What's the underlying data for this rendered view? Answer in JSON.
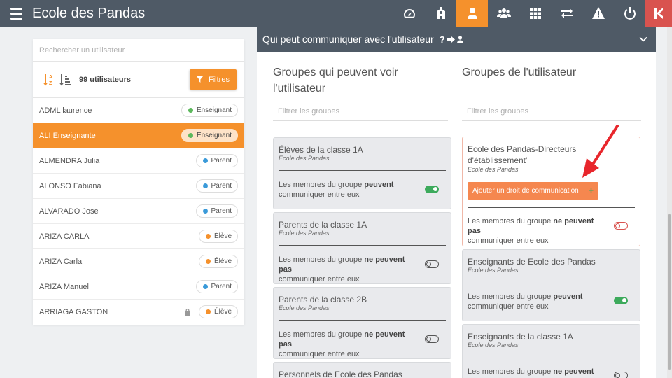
{
  "app": {
    "title": "Ecole des Pandas"
  },
  "user_list": {
    "search_placeholder": "Rechercher un utilisateur",
    "count": "99 utilisateurs",
    "filter_label": "Filtres",
    "users": [
      {
        "name": "ADML laurence",
        "role": "Enseignant",
        "role_color": "#5cb85c"
      },
      {
        "name": "ALI Enseignante",
        "role": "Enseignant",
        "role_color": "#5cb85c"
      },
      {
        "name": "ALMENDRA Julia",
        "role": "Parent",
        "role_color": "#3a9ad9"
      },
      {
        "name": "ALONSO Fabiana",
        "role": "Parent",
        "role_color": "#3a9ad9"
      },
      {
        "name": "ALVARADO Jose",
        "role": "Parent",
        "role_color": "#3a9ad9"
      },
      {
        "name": "ARIZA CARLA",
        "role": "Élève",
        "role_color": "#f5912c"
      },
      {
        "name": "ARIZA Carla",
        "role": "Élève",
        "role_color": "#f5912c"
      },
      {
        "name": "ARIZA Manuel",
        "role": "Parent",
        "role_color": "#3a9ad9"
      },
      {
        "name": "ARRIAGA GASTON",
        "role": "Élève",
        "role_color": "#f5912c"
      }
    ]
  },
  "panel": {
    "header_title": "Qui peut communiquer avec l'utilisateur",
    "header_mark": "?",
    "left_title": "Groupes qui peuvent voir l'utilisateur",
    "right_title": "Groupes de l'utilisateur",
    "filter_placeholder": "Filtrer les groupes",
    "add_button_label": "Ajouter un droit de communication",
    "add_button_plus": "+",
    "left_groups": [
      {
        "title": "Élèves de la classe 1A",
        "school": "Ecole des Pandas",
        "desc_pre": "Les membres du groupe ",
        "desc_bold": "peuvent",
        "desc_post": "communiquer entre eux"
      },
      {
        "title": "Parents de la classe 1A",
        "school": "Ecole des Pandas",
        "desc_pre": "Les membres du groupe ",
        "desc_bold": "ne peuvent pas",
        "desc_post": "communiquer entre eux"
      },
      {
        "title": "Parents de la classe 2B",
        "school": "Ecole des Pandas",
        "desc_pre": "Les membres du groupe ",
        "desc_bold": "ne peuvent pas",
        "desc_post": "communiquer entre eux"
      },
      {
        "title": "Personnels de Ecole des Pandas"
      }
    ],
    "right_groups": [
      {
        "title": "Ecole des Pandas-Directeurs d'établissement'",
        "school": "Ecole des Pandas",
        "desc_pre": "Les membres du groupe ",
        "desc_bold": "ne peuvent pas",
        "desc_post": "communiquer entre eux"
      },
      {
        "title": "Enseignants de Ecole des Pandas",
        "school": "Ecole des Pandas",
        "desc_pre": "Les membres du groupe ",
        "desc_bold": "peuvent",
        "desc_post": "communiquer entre eux"
      },
      {
        "title": "Enseignants de la classe 1A",
        "school": "Ecole des Pandas",
        "desc_pre": "Les membres du groupe ",
        "desc_bold": "ne peuvent pas"
      }
    ]
  },
  "colors": {
    "accent": "#f5912c",
    "topbar": "#4f5a66",
    "toggle_on": "#3daa5c",
    "danger": "#d9534f"
  }
}
